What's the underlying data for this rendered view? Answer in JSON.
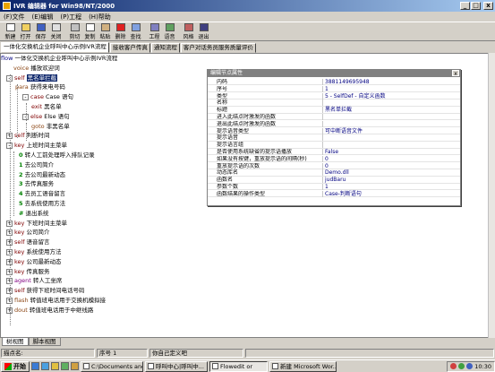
{
  "window": {
    "title": "IVR 编辑器 for Win98/NT/2000",
    "minimize": "_",
    "maximize": "□",
    "close": "x"
  },
  "menu": [
    "(F)文件",
    "(E)编辑",
    "(P)工程",
    "(H)帮助"
  ],
  "toolbar": [
    {
      "label": "新建",
      "icon": "new-file-icon",
      "color": "#ffffff"
    },
    {
      "label": "打开",
      "icon": "open-folder-icon",
      "color": "#f0d060"
    },
    {
      "label": "保存",
      "icon": "save-disk-icon",
      "color": "#4060c0"
    },
    {
      "label": "关闭",
      "icon": "close-doc-icon",
      "color": "#e0e0e0"
    },
    {
      "label": "剪切",
      "icon": "cut-icon",
      "color": "#c0c0c0"
    },
    {
      "label": "复制",
      "icon": "copy-icon",
      "color": "#ffffff"
    },
    {
      "label": "粘贴",
      "icon": "paste-icon",
      "color": "#d0b080"
    },
    {
      "label": "删除",
      "icon": "delete-icon",
      "color": "#e02020"
    },
    {
      "label": "查找",
      "icon": "find-icon",
      "color": "#80a0e0"
    },
    {
      "label": "工程",
      "icon": "project-icon",
      "color": "#8080c0"
    },
    {
      "label": "语音",
      "icon": "voice-icon",
      "color": "#60a060"
    },
    {
      "label": "风格",
      "icon": "style-icon",
      "color": "#c06060"
    },
    {
      "label": "退出",
      "icon": "exit-icon",
      "color": "#404080"
    }
  ],
  "tabs": [
    {
      "label": "一体化交换机企业呼叫中心示例IVR流程",
      "active": true
    },
    {
      "label": "接收客户传真",
      "active": false
    },
    {
      "label": "通知流程",
      "active": false
    },
    {
      "label": "客户对话务员服务质量评价",
      "active": false
    }
  ],
  "tree": [
    {
      "kw": "flow",
      "kwClass": "kw-blue",
      "text": " 一体化交换机企业呼叫中心示例IVR流程"
    },
    {
      "kw": "voice",
      "kwClass": "kw-brown",
      "text": " 播放欢迎词"
    },
    {
      "kw": "self",
      "kwClass": "kw",
      "text": "",
      "sel": "黑名单拦截"
    },
    {
      "kw": "para",
      "kwClass": "kw-brown",
      "text": " 获得来电号码"
    },
    {
      "kw": "case",
      "kwClass": "kw",
      "text": " Case 语句"
    },
    {
      "kw": "exit",
      "kwClass": "kw",
      "text": " 黑名单"
    },
    {
      "kw": "else",
      "kwClass": "kw",
      "text": " Else 语句"
    },
    {
      "kw": "goto",
      "kwClass": "kw-brown",
      "text": " 非黑名单"
    },
    {
      "kw": "self",
      "kwClass": "kw",
      "text": " 判断时间"
    },
    {
      "kw": "key",
      "kwClass": "kw",
      "text": " 上班时间主菜单"
    },
    {
      "kw": "0",
      "kwClass": "num",
      "text": "   转人工前处理呼入排队记录"
    },
    {
      "kw": "1",
      "kwClass": "num",
      "text": "   去公司简介"
    },
    {
      "kw": "2",
      "kwClass": "num",
      "text": "   去公司最新动态"
    },
    {
      "kw": "3",
      "kwClass": "num",
      "text": "   去传真服务"
    },
    {
      "kw": "4",
      "kwClass": "num",
      "text": "   去员工语音留言"
    },
    {
      "kw": "5",
      "kwClass": "num",
      "text": "   去系统使用方法"
    },
    {
      "kw": "#",
      "kwClass": "num",
      "text": "   退出系统"
    },
    {
      "kw": "key",
      "kwClass": "kw",
      "text": " 下班时间主菜单"
    },
    {
      "kw": "key",
      "kwClass": "kw",
      "text": " 公司简介"
    },
    {
      "kw": "self",
      "kwClass": "kw",
      "text": " 语音留言"
    },
    {
      "kw": "key",
      "kwClass": "kw",
      "text": " 系统使用方法"
    },
    {
      "kw": "key",
      "kwClass": "kw",
      "text": " 公司最新动态"
    },
    {
      "kw": "key",
      "kwClass": "kw",
      "text": " 传真服务"
    },
    {
      "kw": "agent",
      "kwClass": "kw-purple",
      "text": " 转人工坐席"
    },
    {
      "kw": "self",
      "kwClass": "kw",
      "text": " 获得下班时间电话号码"
    },
    {
      "kw": "flash",
      "kwClass": "kw-brown",
      "text": " 转值班电话用于交换机模拟接"
    },
    {
      "kw": "dout",
      "kwClass": "kw-brown",
      "text": " 转值班电话用于中继线路"
    }
  ],
  "prop": {
    "title": "编辑节点属性",
    "close": "x",
    "rows": [
      {
        "k": "内码",
        "v": "3881149695948"
      },
      {
        "k": "序号",
        "v": "1"
      },
      {
        "k": "类型",
        "v": "5 - SelfDef - 自定义函数"
      },
      {
        "k": "名称",
        "v": ""
      },
      {
        "k": "标题",
        "v": "黑名单拦截"
      },
      {
        "k": "进入此结点时激发的函数",
        "v": ""
      },
      {
        "k": "退出此结点时激发的函数",
        "v": ""
      },
      {
        "k": "提示语音类型",
        "v": "可中断语音文件"
      },
      {
        "k": "提示语音",
        "v": ""
      },
      {
        "k": "提示语言组",
        "v": ""
      },
      {
        "k": "是否使用系统缺省的提示语播放",
        "v": "False"
      },
      {
        "k": "如果没有按键，重放提示语的间隔(秒)",
        "v": "0"
      },
      {
        "k": "重放提示语的次数",
        "v": "0"
      },
      {
        "k": "动态库名",
        "v": "Demo.dll"
      },
      {
        "k": "函数名",
        "v": "judBaru"
      },
      {
        "k": "参数个数",
        "v": "1"
      },
      {
        "k": "函数结果的操作类型",
        "v": "Case-判断语句"
      }
    ]
  },
  "bottom_tabs": [
    {
      "label": "树视图",
      "active": true
    },
    {
      "label": "脚本视图",
      "active": false
    }
  ],
  "status": [
    {
      "text": "描点名:"
    },
    {
      "text": "序号 1"
    },
    {
      "text": "你自己定义吧"
    },
    {
      "text": ""
    }
  ],
  "taskbar": {
    "start": "开始",
    "quick_icons": [
      "ie-icon",
      "desktop-icon",
      "outlook-icon",
      "media-icon",
      "folder-icon"
    ],
    "tasks": [
      {
        "label": "C:\\Documents and ...",
        "active": false
      },
      {
        "label": "呼叫中心|呼叫中...",
        "active": false
      },
      {
        "label": "Flowedit or",
        "active": true
      },
      {
        "label": "新建 Microsoft Wor...",
        "active": false
      }
    ],
    "time": "10:30"
  }
}
